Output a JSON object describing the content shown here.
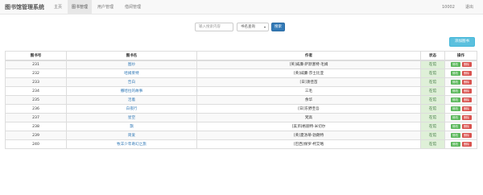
{
  "navbar": {
    "brand": "图书馆管理系统",
    "items": [
      {
        "label": "主页",
        "active": false
      },
      {
        "label": "图书管理",
        "active": true
      },
      {
        "label": "用户管理",
        "active": false
      },
      {
        "label": "借阅管理",
        "active": false
      }
    ],
    "user_id": "10002",
    "logout_label": "退出"
  },
  "search": {
    "placeholder": "输入搜索内容",
    "select_value": "书名查询",
    "button_label": "搜索"
  },
  "add_button_label": "添加图书",
  "table": {
    "headers": [
      "图书号",
      "图书名",
      "作者",
      "状态",
      "操作"
    ],
    "edit_label": "修改",
    "delete_label": "删除",
    "rows": [
      {
        "id": "231",
        "name": "图纱",
        "author": "[英]威廉·萨默塞特·毛姆",
        "status": "在馆"
      },
      {
        "id": "232",
        "name": "哈姆莱特",
        "author": "[英]威廉·莎士比亚",
        "status": "在馆"
      },
      {
        "id": "233",
        "name": "告白",
        "author": "[日]凑佳苗",
        "status": "在馆"
      },
      {
        "id": "234",
        "name": "撒哈拉的故事",
        "author": "三毛",
        "status": "在馆"
      },
      {
        "id": "235",
        "name": "活着",
        "author": "余华",
        "status": "在馆"
      },
      {
        "id": "236",
        "name": "白夜行",
        "author": "[日]东野圭吾",
        "status": "在馆"
      },
      {
        "id": "237",
        "name": "星空",
        "author": "梵高",
        "status": "在馆"
      },
      {
        "id": "238",
        "name": "飘",
        "author": "[美]玛格丽特·米切尔",
        "status": "在馆"
      },
      {
        "id": "239",
        "name": "简爱",
        "author": "[英]夏洛蒂·勃朗特",
        "status": "在馆"
      },
      {
        "id": "240",
        "name": "牧羊少年奇幻之旅",
        "author": "[巴西]保罗·柯艾略",
        "status": "在馆"
      }
    ]
  }
}
